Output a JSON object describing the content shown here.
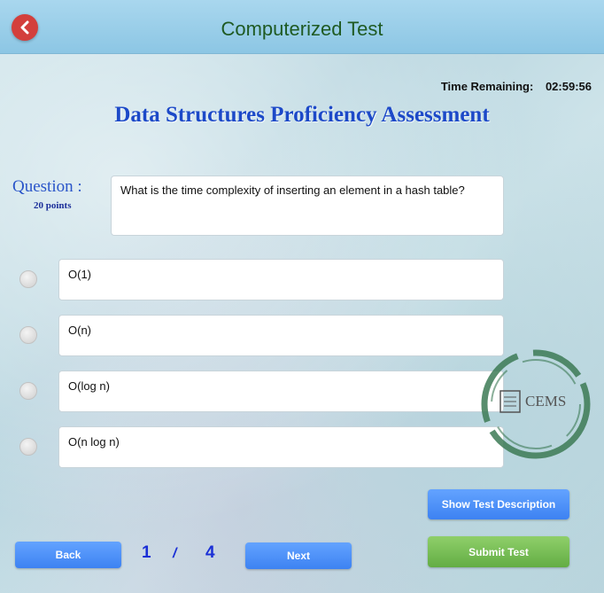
{
  "header": {
    "title": "Computerized Test"
  },
  "timer": {
    "label": "Time Remaining:",
    "value": "02:59:56"
  },
  "assessment_title": "Data Structures Proficiency Assessment",
  "question": {
    "label": "Question :",
    "points": "20 points",
    "text": "What is the time complexity of inserting an element in a hash table?"
  },
  "options": [
    {
      "text": "O(1)"
    },
    {
      "text": "O(n)"
    },
    {
      "text": "O(log n)"
    },
    {
      "text": "O(n log n)"
    }
  ],
  "nav": {
    "back_label": "Back",
    "next_label": "Next",
    "current_page": "1",
    "separator": "/",
    "total_pages": "4"
  },
  "actions": {
    "show_description_label": "Show Test Description",
    "submit_label": "Submit Test"
  },
  "logo": {
    "text": "CEMS",
    "color": "#3c7a55"
  },
  "colors": {
    "title_bar": "#9fd0ea",
    "heading": "#1c49c8",
    "button_blue": "#4a8ef5",
    "button_green": "#72bb52",
    "back_circle": "#d33f3c"
  }
}
